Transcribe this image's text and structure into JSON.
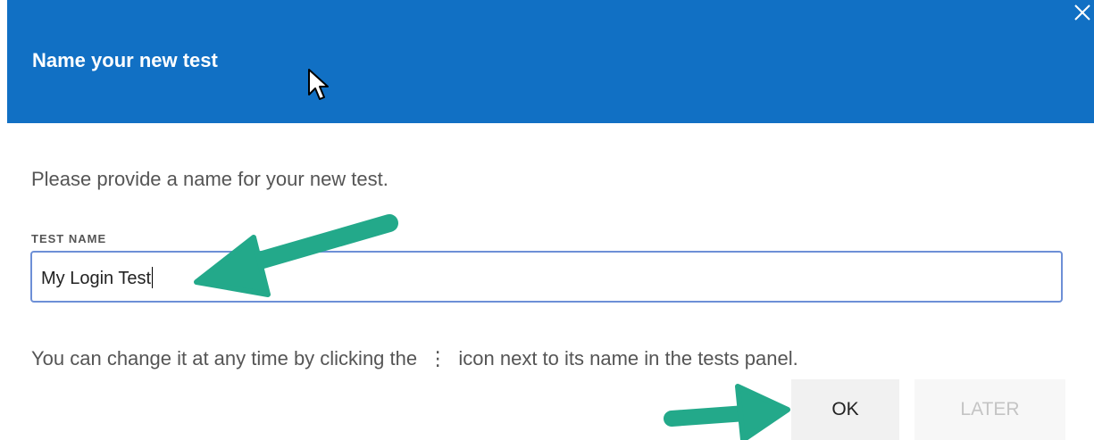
{
  "dialog": {
    "title": "Name your new test",
    "close_icon": "close-icon",
    "prompt": "Please provide a name for your new test.",
    "field_label": "TEST NAME",
    "field_value": "My Login Test",
    "hint_before": "You can change it at any time by clicking the",
    "hint_icon": "⋮",
    "hint_after": "icon next to its name in the tests panel.",
    "ok_label": "OK",
    "later_label": "LATER"
  },
  "colors": {
    "header": "#1170c4",
    "annotation_arrow": "#23a98a",
    "input_border": "#6d8fd6"
  }
}
